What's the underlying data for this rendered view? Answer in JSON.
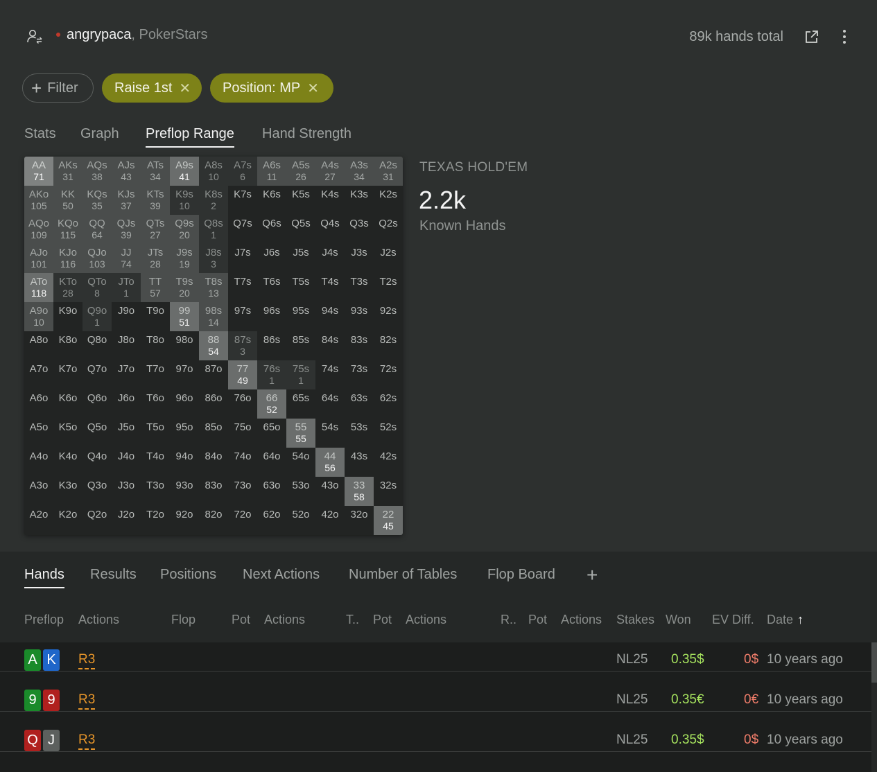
{
  "header": {
    "username": "angrypaca",
    "site": ", PokerStars",
    "hands_total": "89k hands total",
    "status_color": "#c0392b"
  },
  "filters": {
    "add_label": "Filter",
    "chips": [
      "Raise 1st",
      "Position: MP"
    ],
    "chip_color": "#7d8218"
  },
  "tabs": [
    "Stats",
    "Graph",
    "Preflop Range",
    "Hand Strength"
  ],
  "active_tab": "Preflop Range",
  "summary": {
    "game": "TEXAS HOLD'EM",
    "count": "2.2k",
    "count_label": "Known Hands"
  },
  "range": {
    "rows": [
      [
        [
          "AA",
          "71",
          4
        ],
        [
          "AKs",
          "31",
          2
        ],
        [
          "AQs",
          "38",
          2
        ],
        [
          "AJs",
          "43",
          2
        ],
        [
          "ATs",
          "34",
          2
        ],
        [
          "A9s",
          "41",
          3
        ],
        [
          "A8s",
          "10",
          1
        ],
        [
          "A7s",
          "6",
          1
        ],
        [
          "A6s",
          "11",
          2
        ],
        [
          "A5s",
          "26",
          2
        ],
        [
          "A4s",
          "27",
          2
        ],
        [
          "A3s",
          "34",
          2
        ],
        [
          "A2s",
          "31",
          2
        ]
      ],
      [
        [
          "AKo",
          "105",
          2
        ],
        [
          "KK",
          "50",
          2
        ],
        [
          "KQs",
          "35",
          2
        ],
        [
          "KJs",
          "37",
          2
        ],
        [
          "KTs",
          "39",
          2
        ],
        [
          "K9s",
          "10",
          1
        ],
        [
          "K8s",
          "2",
          1
        ],
        [
          "K7s",
          "",
          0
        ],
        [
          "K6s",
          "",
          0
        ],
        [
          "K5s",
          "",
          0
        ],
        [
          "K4s",
          "",
          0
        ],
        [
          "K3s",
          "",
          0
        ],
        [
          "K2s",
          "",
          0
        ]
      ],
      [
        [
          "AQo",
          "109",
          2
        ],
        [
          "KQo",
          "115",
          2
        ],
        [
          "QQ",
          "64",
          2
        ],
        [
          "QJs",
          "39",
          2
        ],
        [
          "QTs",
          "27",
          2
        ],
        [
          "Q9s",
          "20",
          2
        ],
        [
          "Q8s",
          "1",
          1
        ],
        [
          "Q7s",
          "",
          0
        ],
        [
          "Q6s",
          "",
          0
        ],
        [
          "Q5s",
          "",
          0
        ],
        [
          "Q4s",
          "",
          0
        ],
        [
          "Q3s",
          "",
          0
        ],
        [
          "Q2s",
          "",
          0
        ]
      ],
      [
        [
          "AJo",
          "101",
          2
        ],
        [
          "KJo",
          "116",
          2
        ],
        [
          "QJo",
          "103",
          2
        ],
        [
          "JJ",
          "74",
          2
        ],
        [
          "JTs",
          "28",
          2
        ],
        [
          "J9s",
          "19",
          2
        ],
        [
          "J8s",
          "3",
          1
        ],
        [
          "J7s",
          "",
          0
        ],
        [
          "J6s",
          "",
          0
        ],
        [
          "J5s",
          "",
          0
        ],
        [
          "J4s",
          "",
          0
        ],
        [
          "J3s",
          "",
          0
        ],
        [
          "J2s",
          "",
          0
        ]
      ],
      [
        [
          "ATo",
          "118",
          3
        ],
        [
          "KTo",
          "28",
          1
        ],
        [
          "QTo",
          "8",
          1
        ],
        [
          "JTo",
          "1",
          1
        ],
        [
          "TT",
          "57",
          2
        ],
        [
          "T9s",
          "20",
          2
        ],
        [
          "T8s",
          "13",
          2
        ],
        [
          "T7s",
          "",
          0
        ],
        [
          "T6s",
          "",
          0
        ],
        [
          "T5s",
          "",
          0
        ],
        [
          "T4s",
          "",
          0
        ],
        [
          "T3s",
          "",
          0
        ],
        [
          "T2s",
          "",
          0
        ]
      ],
      [
        [
          "A9o",
          "10",
          2
        ],
        [
          "K9o",
          "",
          0
        ],
        [
          "Q9o",
          "1",
          1
        ],
        [
          "J9o",
          "",
          0
        ],
        [
          "T9o",
          "",
          0
        ],
        [
          "99",
          "51",
          3
        ],
        [
          "98s",
          "14",
          2
        ],
        [
          "97s",
          "",
          0
        ],
        [
          "96s",
          "",
          0
        ],
        [
          "95s",
          "",
          0
        ],
        [
          "94s",
          "",
          0
        ],
        [
          "93s",
          "",
          0
        ],
        [
          "92s",
          "",
          0
        ]
      ],
      [
        [
          "A8o",
          "",
          0
        ],
        [
          "K8o",
          "",
          0
        ],
        [
          "Q8o",
          "",
          0
        ],
        [
          "J8o",
          "",
          0
        ],
        [
          "T8o",
          "",
          0
        ],
        [
          "98o",
          "",
          0
        ],
        [
          "88",
          "54",
          3
        ],
        [
          "87s",
          "3",
          1
        ],
        [
          "86s",
          "",
          0
        ],
        [
          "85s",
          "",
          0
        ],
        [
          "84s",
          "",
          0
        ],
        [
          "83s",
          "",
          0
        ],
        [
          "82s",
          "",
          0
        ]
      ],
      [
        [
          "A7o",
          "",
          0
        ],
        [
          "K7o",
          "",
          0
        ],
        [
          "Q7o",
          "",
          0
        ],
        [
          "J7o",
          "",
          0
        ],
        [
          "T7o",
          "",
          0
        ],
        [
          "97o",
          "",
          0
        ],
        [
          "87o",
          "",
          0
        ],
        [
          "77",
          "49",
          3
        ],
        [
          "76s",
          "1",
          1
        ],
        [
          "75s",
          "1",
          1
        ],
        [
          "74s",
          "",
          0
        ],
        [
          "73s",
          "",
          0
        ],
        [
          "72s",
          "",
          0
        ]
      ],
      [
        [
          "A6o",
          "",
          0
        ],
        [
          "K6o",
          "",
          0
        ],
        [
          "Q6o",
          "",
          0
        ],
        [
          "J6o",
          "",
          0
        ],
        [
          "T6o",
          "",
          0
        ],
        [
          "96o",
          "",
          0
        ],
        [
          "86o",
          "",
          0
        ],
        [
          "76o",
          "",
          0
        ],
        [
          "66",
          "52",
          3
        ],
        [
          "65s",
          "",
          0
        ],
        [
          "64s",
          "",
          0
        ],
        [
          "63s",
          "",
          0
        ],
        [
          "62s",
          "",
          0
        ]
      ],
      [
        [
          "A5o",
          "",
          0
        ],
        [
          "K5o",
          "",
          0
        ],
        [
          "Q5o",
          "",
          0
        ],
        [
          "J5o",
          "",
          0
        ],
        [
          "T5o",
          "",
          0
        ],
        [
          "95o",
          "",
          0
        ],
        [
          "85o",
          "",
          0
        ],
        [
          "75o",
          "",
          0
        ],
        [
          "65o",
          "",
          0
        ],
        [
          "55",
          "55",
          3
        ],
        [
          "54s",
          "",
          0
        ],
        [
          "53s",
          "",
          0
        ],
        [
          "52s",
          "",
          0
        ]
      ],
      [
        [
          "A4o",
          "",
          0
        ],
        [
          "K4o",
          "",
          0
        ],
        [
          "Q4o",
          "",
          0
        ],
        [
          "J4o",
          "",
          0
        ],
        [
          "T4o",
          "",
          0
        ],
        [
          "94o",
          "",
          0
        ],
        [
          "84o",
          "",
          0
        ],
        [
          "74o",
          "",
          0
        ],
        [
          "64o",
          "",
          0
        ],
        [
          "54o",
          "",
          0
        ],
        [
          "44",
          "56",
          3
        ],
        [
          "43s",
          "",
          0
        ],
        [
          "42s",
          "",
          0
        ]
      ],
      [
        [
          "A3o",
          "",
          0
        ],
        [
          "K3o",
          "",
          0
        ],
        [
          "Q3o",
          "",
          0
        ],
        [
          "J3o",
          "",
          0
        ],
        [
          "T3o",
          "",
          0
        ],
        [
          "93o",
          "",
          0
        ],
        [
          "83o",
          "",
          0
        ],
        [
          "73o",
          "",
          0
        ],
        [
          "63o",
          "",
          0
        ],
        [
          "53o",
          "",
          0
        ],
        [
          "43o",
          "",
          0
        ],
        [
          "33",
          "58",
          3
        ],
        [
          "32s",
          "",
          0
        ]
      ],
      [
        [
          "A2o",
          "",
          0
        ],
        [
          "K2o",
          "",
          0
        ],
        [
          "Q2o",
          "",
          0
        ],
        [
          "J2o",
          "",
          0
        ],
        [
          "T2o",
          "",
          0
        ],
        [
          "92o",
          "",
          0
        ],
        [
          "82o",
          "",
          0
        ],
        [
          "72o",
          "",
          0
        ],
        [
          "62o",
          "",
          0
        ],
        [
          "52o",
          "",
          0
        ],
        [
          "42o",
          "",
          0
        ],
        [
          "32o",
          "",
          0
        ],
        [
          "22",
          "45",
          3
        ]
      ]
    ]
  },
  "bottom_tabs": [
    "Hands",
    "Results",
    "Positions",
    "Next Actions",
    "Number of Tables",
    "Flop Board"
  ],
  "active_bottom_tab": "Hands",
  "columns": [
    "Preflop",
    "Actions",
    "Flop",
    "Pot",
    "Actions",
    "T..",
    "Pot",
    "Actions",
    "R..",
    "Pot",
    "Actions",
    "Stakes",
    "Won",
    "EV Diff.",
    "Date"
  ],
  "sort_arrow": "↑",
  "hands": [
    {
      "cards": [
        {
          "rank": "A",
          "color": "#1a8a2a"
        },
        {
          "rank": "K",
          "color": "#1f66c9"
        }
      ],
      "action": "R3",
      "stakes": "NL25",
      "won": "0.35$",
      "ev": "0$",
      "date": "10 years ago"
    },
    {
      "cards": [
        {
          "rank": "9",
          "color": "#1a8a2a"
        },
        {
          "rank": "9",
          "color": "#b0201e"
        }
      ],
      "action": "R3",
      "stakes": "NL25",
      "won": "0.35€",
      "ev": "0€",
      "date": "10 years ago"
    },
    {
      "cards": [
        {
          "rank": "Q",
          "color": "#b0201e"
        },
        {
          "rank": "J",
          "color": "#5c605e"
        }
      ],
      "action": "R3",
      "stakes": "NL25",
      "won": "0.35$",
      "ev": "0$",
      "date": "10 years ago"
    }
  ]
}
